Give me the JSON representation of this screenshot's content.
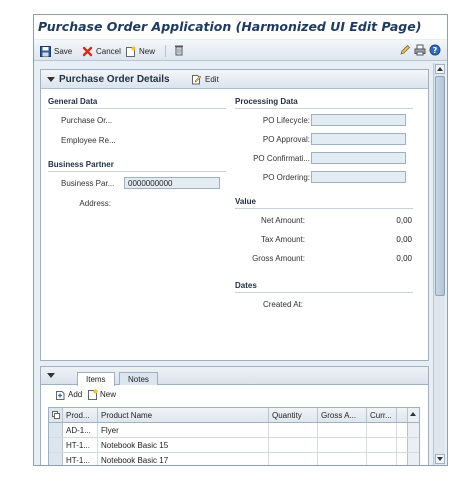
{
  "app": {
    "title": "Purchase Order Application (Harmonized UI Edit Page)"
  },
  "toolbar": {
    "save_label": "Save",
    "cancel_label": "Cancel",
    "new_label": "New"
  },
  "details": {
    "title": "Purchase Order Details",
    "edit_label": "Edit",
    "general": {
      "title": "General Data",
      "purchase_order_label": "Purchase Or...",
      "employee_label": "Employee Re..."
    },
    "business_partner": {
      "title": "Business Partner",
      "bp_label": "Business Par...",
      "bp_value": "0000000000",
      "address_label": "Address:"
    },
    "processing": {
      "title": "Processing Data",
      "lifecycle_label": "PO Lifecycle:",
      "approval_label": "PO Approval:",
      "confirmation_label": "PO Confirmati...",
      "ordering_label": "PO Ordering:"
    },
    "value": {
      "title": "Value",
      "net_label": "Net Amount:",
      "net_value": "0,00",
      "tax_label": "Tax Amount:",
      "tax_value": "0,00",
      "gross_label": "Gross Amount:",
      "gross_value": "0,00"
    },
    "dates": {
      "title": "Dates",
      "created_label": "Created At:"
    }
  },
  "items": {
    "tabs": [
      {
        "label": "Items",
        "active": true
      },
      {
        "label": "Notes",
        "active": false
      }
    ],
    "add_label": "Add",
    "new_label": "New",
    "columns": [
      "Prod...",
      "Product Name",
      "Quantity",
      "Gross A...",
      "Curr..."
    ],
    "rows": [
      {
        "product": "AD-1...",
        "name": "Flyer"
      },
      {
        "product": "HT-1...",
        "name": "Notebook Basic 15"
      },
      {
        "product": "HT-1...",
        "name": "Notebook Basic 17"
      }
    ]
  },
  "icons": {
    "save": "floppy-disk-icon",
    "cancel": "red-x-icon",
    "new": "new-document-icon",
    "delete": "trash-icon",
    "edit": "pencil-icon",
    "print": "printer-icon",
    "help": "help-icon"
  },
  "colors": {
    "title": "#1f3a5c",
    "field_bg": "#e4ecf3",
    "cancel_red": "#d52b1e"
  }
}
